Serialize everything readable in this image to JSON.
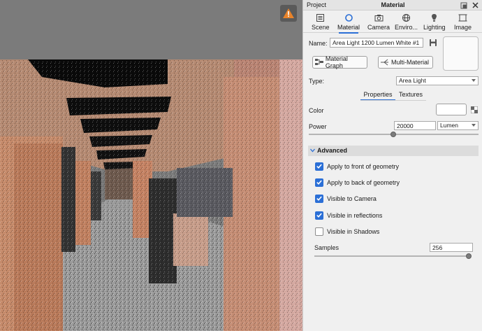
{
  "panel": {
    "project_label": "Project",
    "title": "Material",
    "window_icons": [
      "pop-out-icon",
      "close-icon"
    ]
  },
  "tabs": [
    {
      "label": "Scene",
      "icon": "scene-icon",
      "active": false
    },
    {
      "label": "Material",
      "icon": "material-icon",
      "active": true
    },
    {
      "label": "Camera",
      "icon": "camera-icon",
      "active": false
    },
    {
      "label": "Enviro...",
      "icon": "environment-icon",
      "active": false
    },
    {
      "label": "Lighting",
      "icon": "lighting-icon",
      "active": false
    },
    {
      "label": "Image",
      "icon": "image-icon",
      "active": false
    }
  ],
  "material": {
    "name_label": "Name:",
    "name_value": "Area Light 1200 Lumen White #1",
    "material_graph_label": "Material Graph",
    "multi_material_label": "Multi-Material",
    "type_label": "Type:",
    "type_value": "Area Light"
  },
  "subtabs": {
    "properties": "Properties",
    "textures": "Textures",
    "active": "properties"
  },
  "properties": {
    "color_label": "Color",
    "color_value": "#ffffff",
    "power_label": "Power",
    "power_value": "20000",
    "power_unit": "Lumen"
  },
  "advanced": {
    "header": "Advanced",
    "options": [
      {
        "label": "Apply to front of geometry",
        "checked": true
      },
      {
        "label": "Apply to back of geometry",
        "checked": true
      },
      {
        "label": "Visible to Camera",
        "checked": true
      },
      {
        "label": "Visible in reflections",
        "checked": true
      },
      {
        "label": "Visible in Shadows",
        "checked": false
      }
    ],
    "samples_label": "Samples",
    "samples_value": "256"
  },
  "colors": {
    "accent": "#2b6fd6",
    "warning": "#e8832a"
  }
}
